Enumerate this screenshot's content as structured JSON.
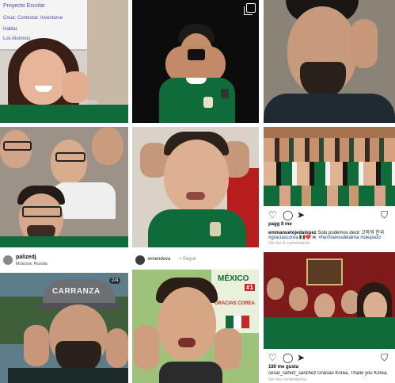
{
  "grid": {
    "tile1": {
      "whiteboard_lines": [
        "Proyecto Escolar",
        "Crear, Contestar, Inventarse",
        "Hablar",
        "Los Alumnos"
      ]
    },
    "tile8": {
      "caption_lines": [
        "MÉXICO",
        "GRACIAS COREA",
        "#1"
      ]
    },
    "post_emmanuel": {
      "likes": "pagg 8 me",
      "username": "emmanuelojedalopez",
      "caption": "Solo podemos decir 고마워 한국",
      "hashtags": "#graciascorea 🇲🇽❤️🇰🇷 #hermanosdelalma #siiepudo",
      "comments": "Ver los 8 comentarios"
    },
    "post_palized": {
      "username": "palizedj",
      "location": "Moscow, Russia",
      "counter": "2/4",
      "hat_text": "CARRANZA"
    },
    "post_ernesto": {
      "username": "ernendova",
      "meta": "• Seguir"
    },
    "post_cesar": {
      "likes": "180 me gusta",
      "caption": "cesar_ramirz_sanchez Gracias Korea, Thank you Korea,",
      "comments": "Ver los comentarios"
    }
  }
}
